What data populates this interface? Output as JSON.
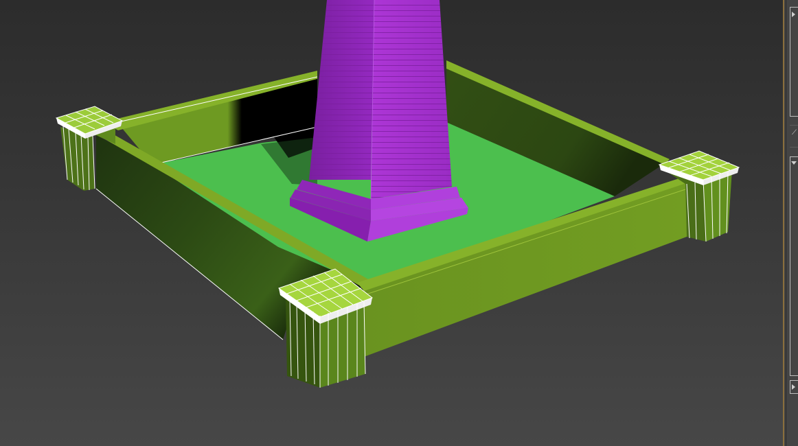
{
  "viewport": {
    "scene_objects": [
      "pedestal-column",
      "planter-box",
      "grass-bed",
      "corner-post-left",
      "corner-post-front",
      "corner-post-right"
    ]
  },
  "command_panel": {
    "rollouts": [
      {
        "name": "rollout-1",
        "state": "expanded"
      },
      {
        "name": "rollout-2",
        "state": "expanded"
      },
      {
        "name": "rollout-3",
        "state": "collapsed"
      }
    ],
    "icons": [
      "expand-arrow-icon",
      "pick-icon",
      "collapse-arrow-icon"
    ]
  },
  "colors": {
    "viewport_bg_top": "#2c2c2c",
    "viewport_bg_bottom": "#474747",
    "column": "#a932d2",
    "column_shade": "#8a22b4",
    "planter": "#6f9a1f",
    "grass": "#4cbf4e",
    "wireframe": "#ffffff",
    "panel_accent": "#8a6f3c"
  }
}
